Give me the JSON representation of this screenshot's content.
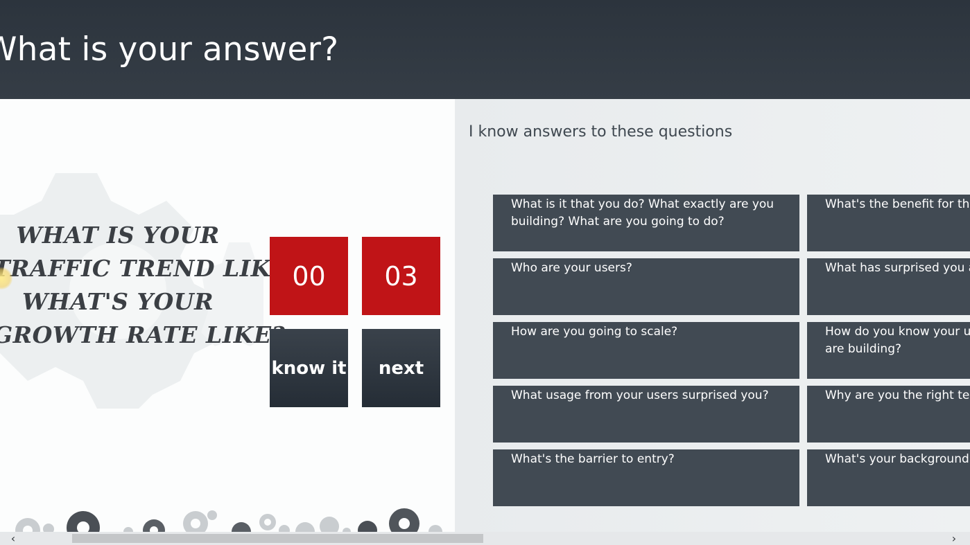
{
  "header": {
    "title": "What is your answer?"
  },
  "question": {
    "lines": [
      "WHAT IS YOUR",
      "TRAFFIC TREND LIKE?",
      "WHAT'S YOUR",
      "GROWTH RATE LIKE?"
    ]
  },
  "timer": {
    "minutes": "00",
    "seconds": "03"
  },
  "actions": {
    "know_it_label": "know it",
    "next_label": "next"
  },
  "known_section": {
    "label": "I know answers to these questions",
    "column1": [
      "What is it that you do? What exactly are you building? What are you going to do?",
      "Who are your users?",
      "How are you going to scale?",
      "What usage from your users surprised you?",
      "What's the barrier to entry?"
    ],
    "column2": [
      "What's the benefit for the",
      "What has surprised you ab",
      "How do you know your us",
      "are building?",
      "Why are you the right tear",
      "What's your background in"
    ]
  },
  "colors": {
    "header_bg": "#2c343d",
    "timer_red": "#c01417",
    "card_bg": "#414a53",
    "button_dark": "#2b333c"
  },
  "icons": {
    "scroll_left": "‹",
    "scroll_right": "›"
  }
}
